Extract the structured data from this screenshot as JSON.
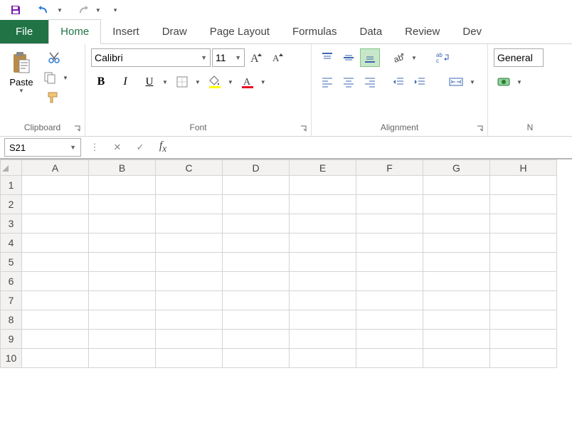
{
  "qat": {
    "save": "save",
    "undo": "undo",
    "redo": "redo",
    "custom": "custom"
  },
  "tabs": {
    "file": "File",
    "items": [
      "Home",
      "Insert",
      "Draw",
      "Page Layout",
      "Formulas",
      "Data",
      "Review",
      "Dev"
    ],
    "active_index": 0
  },
  "ribbon": {
    "clipboard": {
      "label": "Clipboard",
      "paste": "Paste"
    },
    "font": {
      "label": "Font",
      "name": "Calibri",
      "size": "11"
    },
    "alignment": {
      "label": "Alignment"
    },
    "number": {
      "label": "N",
      "format": "General"
    }
  },
  "formula_bar": {
    "name_box": "S21",
    "formula": ""
  },
  "grid": {
    "columns": [
      "A",
      "B",
      "C",
      "D",
      "E",
      "F",
      "G",
      "H"
    ],
    "rows": [
      "1",
      "2",
      "3",
      "4",
      "5",
      "6",
      "7",
      "8",
      "9",
      "10"
    ]
  }
}
